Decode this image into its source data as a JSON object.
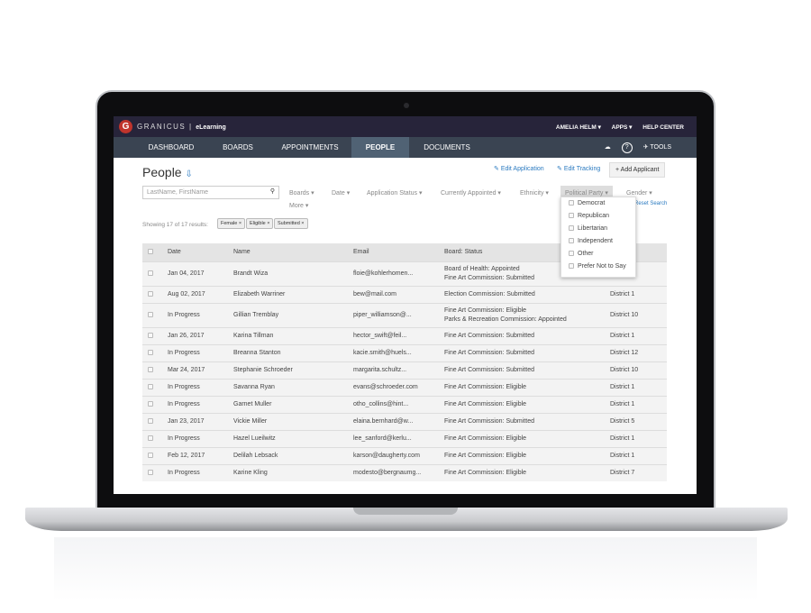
{
  "app": {
    "logo_letter": "G",
    "brand": "GRANICUS",
    "product": "eLearning"
  },
  "top_links": [
    "AMELIA HELM ▾",
    "APPS ▾",
    "HELP CENTER"
  ],
  "nav": {
    "items": [
      "DASHBOARD",
      "BOARDS",
      "APPOINTMENTS",
      "PEOPLE",
      "DOCUMENTS"
    ],
    "active": "PEOPLE",
    "tools": "TOOLS"
  },
  "page": {
    "title": "People",
    "edit_application": "Edit Application",
    "edit_tracking": "Edit Tracking",
    "add_applicant": "+ Add Applicant",
    "reset_search": "Reset Search"
  },
  "search": {
    "placeholder": "LastName, FirstName"
  },
  "filters": [
    "Boards ▾",
    "Date ▾",
    "Application Status ▾",
    "Currently Appointed ▾",
    "Ethnicity ▾",
    "Political Party ▾",
    "Gender ▾",
    "More ▾"
  ],
  "results_text": "Showing 17 of 17 results:",
  "chips": [
    "Female ×",
    "Eligible ×",
    "Submitted ×"
  ],
  "dropdown": [
    "Democrat",
    "Republican",
    "Libertarian",
    "Independent",
    "Other",
    "Prefer Not to Say"
  ],
  "table": {
    "headers": [
      "Date",
      "Name",
      "Email",
      "Board: Status"
    ],
    "rows": [
      [
        "Jan 04, 2017",
        "Brandt Wiza",
        "floie@kohlerhomen...",
        "Board of Health: Appointed\nFine Art Commission: Submitted",
        ""
      ],
      [
        "Aug 02, 2017",
        "Elizabeth Warriner",
        "bew@mail.com",
        "Election Commission: Submitted",
        "District 1"
      ],
      [
        "In Progress",
        "Gillian Tremblay",
        "piper_williamson@...",
        "Fine Art Commission: Eligible\nParks & Recreation Commission: Appointed",
        "District 10"
      ],
      [
        "Jan 26, 2017",
        "Karina Tillman",
        "hector_swift@feil...",
        "Fine Art Commission: Submitted",
        "District 1"
      ],
      [
        "In Progress",
        "Breanna Stanton",
        "kacie.smith@huels...",
        "Fine Art Commission: Submitted",
        "District 12"
      ],
      [
        "Mar 24, 2017",
        "Stephanie Schroeder",
        "margarita.schultz...",
        "Fine Art Commission: Submitted",
        "District 10"
      ],
      [
        "In Progress",
        "Savanna Ryan",
        "evans@schroeder.com",
        "Fine Art Commission: Eligible",
        "District 1"
      ],
      [
        "In Progress",
        "Garnet Muller",
        "otho_collins@hint...",
        "Fine Art Commission: Eligible",
        "District 1"
      ],
      [
        "Jan 23, 2017",
        "Vickie Miller",
        "elaina.bernhard@w...",
        "Fine Art Commission: Submitted",
        "District 5"
      ],
      [
        "In Progress",
        "Hazel Lueilwitz",
        "lee_sanford@kerlu...",
        "Fine Art Commission: Eligible",
        "District 1"
      ],
      [
        "Feb 12, 2017",
        "Delilah Lebsack",
        "karson@daugherty.com",
        "Fine Art Commission: Eligible",
        "District 1"
      ],
      [
        "In Progress",
        "Karine Kling",
        "modesto@bergnaumg...",
        "Fine Art Commission: Eligible",
        "District 7"
      ]
    ]
  }
}
